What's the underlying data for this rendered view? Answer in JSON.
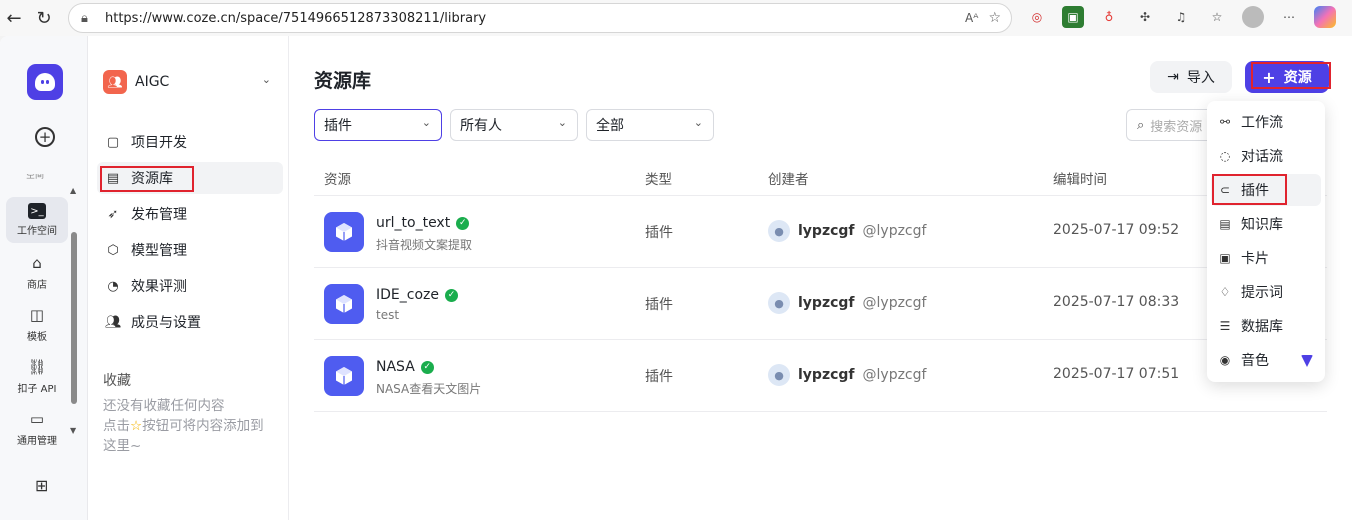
{
  "browser": {
    "url": "https://www.coze.cn/space/7514966512873308211/library"
  },
  "rail": {
    "items": [
      {
        "label": "工作空间"
      },
      {
        "label": "商店"
      },
      {
        "label": "模板"
      },
      {
        "label": "扣子 API"
      },
      {
        "label": "通用管理"
      }
    ],
    "partial_label": "空间"
  },
  "side": {
    "space_name": "AIGC",
    "menu": [
      {
        "label": "项目开发"
      },
      {
        "label": "资源库"
      },
      {
        "label": "发布管理"
      },
      {
        "label": "模型管理"
      },
      {
        "label": "效果评测"
      },
      {
        "label": "成员与设置"
      }
    ],
    "favorites_title": "收藏",
    "favorites_empty_line1": "还没有收藏任何内容",
    "favorites_empty_line2_a": "点击",
    "favorites_empty_line2_b": "按钮可将内容添加到",
    "favorites_empty_line3": "这里~"
  },
  "main": {
    "title": "资源库",
    "import_label": "导入",
    "add_resource_label": "资源",
    "filters": [
      {
        "value": "插件"
      },
      {
        "value": "所有人"
      },
      {
        "value": "全部"
      }
    ],
    "search_placeholder": "搜索资源",
    "columns": [
      "资源",
      "类型",
      "创建者",
      "编辑时间"
    ],
    "rows": [
      {
        "name": "url_to_text",
        "desc": "抖音视频文案提取",
        "type": "插件",
        "creator": "lypzcgf",
        "handle": "@lypzcgf",
        "time": "2025-07-17 09:52"
      },
      {
        "name": "IDE_coze",
        "desc": "test",
        "type": "插件",
        "creator": "lypzcgf",
        "handle": "@lypzcgf",
        "time": "2025-07-17 08:33"
      },
      {
        "name": "NASA",
        "desc": "NASA查看天文图片",
        "type": "插件",
        "creator": "lypzcgf",
        "handle": "@lypzcgf",
        "time": "2025-07-17 07:51"
      }
    ]
  },
  "dropdown": {
    "items": [
      {
        "label": "工作流",
        "icon": "workflow-icon"
      },
      {
        "label": "对话流",
        "icon": "chatflow-icon"
      },
      {
        "label": "插件",
        "icon": "plugin-icon"
      },
      {
        "label": "知识库",
        "icon": "knowledge-icon"
      },
      {
        "label": "卡片",
        "icon": "card-icon"
      },
      {
        "label": "提示词",
        "icon": "prompt-icon"
      },
      {
        "label": "数据库",
        "icon": "database-icon"
      },
      {
        "label": "音色",
        "icon": "voice-icon"
      }
    ]
  },
  "colors": {
    "brand": "#4e40e5",
    "plugin_icon_bg": "#4f5cf0",
    "highlight_box": "#e0232e",
    "verified": "#1aad4d"
  }
}
